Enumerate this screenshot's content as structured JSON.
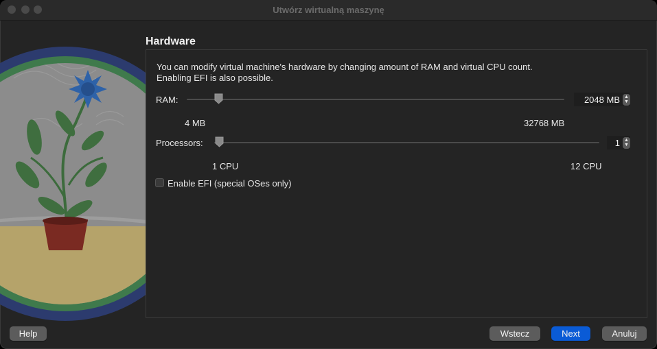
{
  "window": {
    "title": "Utwórz wirtualną maszynę"
  },
  "page": {
    "heading": "Hardware",
    "description_line1": "You can modify virtual machine's hardware by changing amount of RAM and virtual CPU count.",
    "description_line2": "Enabling EFI is also possible."
  },
  "ram": {
    "label": "RAM:",
    "value": "2048 MB",
    "min_label": "4 MB",
    "max_label": "32768 MB",
    "position_fraction": 0.0625
  },
  "processors": {
    "label": "Processors:",
    "value": "1",
    "min_label": "1 CPU",
    "max_label": "12 CPU",
    "position_fraction": 0.0
  },
  "efi": {
    "label": "Enable EFI (special OSes only)",
    "checked": false
  },
  "buttons": {
    "help": "Help",
    "back": "Wstecz",
    "next": "Next",
    "cancel": "Anuluj"
  },
  "colors": {
    "primary_button": "#0a5bd6",
    "window_bg": "#242424"
  },
  "icons": {
    "watermark": "flower-pot-illustration"
  }
}
